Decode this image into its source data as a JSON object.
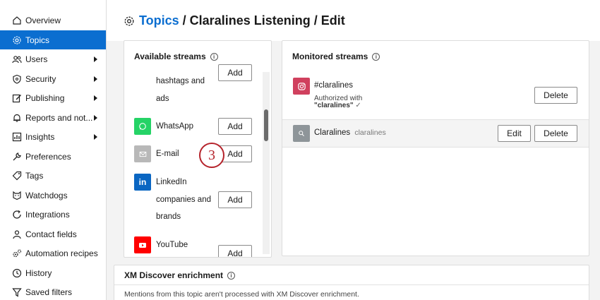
{
  "sidebar": {
    "items": [
      {
        "label": "Overview",
        "icon": "home-icon",
        "has_submenu": false,
        "active": false
      },
      {
        "label": "Topics",
        "icon": "gear-icon",
        "has_submenu": false,
        "active": true
      },
      {
        "label": "Users",
        "icon": "users-icon",
        "has_submenu": true,
        "active": false
      },
      {
        "label": "Security",
        "icon": "shield-icon",
        "has_submenu": true,
        "active": false
      },
      {
        "label": "Publishing",
        "icon": "pencil-icon",
        "has_submenu": true,
        "active": false
      },
      {
        "label": "Reports and not...",
        "icon": "bell-icon",
        "has_submenu": true,
        "active": false
      },
      {
        "label": "Insights",
        "icon": "chart-icon",
        "has_submenu": true,
        "active": false
      },
      {
        "label": "Preferences",
        "icon": "wrench-icon",
        "has_submenu": false,
        "active": false
      },
      {
        "label": "Tags",
        "icon": "tag-icon",
        "has_submenu": false,
        "active": false
      },
      {
        "label": "Watchdogs",
        "icon": "dog-icon",
        "has_submenu": false,
        "active": false
      },
      {
        "label": "Integrations",
        "icon": "refresh-icon",
        "has_submenu": false,
        "active": false
      },
      {
        "label": "Contact fields",
        "icon": "person-icon",
        "has_submenu": false,
        "active": false
      },
      {
        "label": "Automation recipes",
        "icon": "cogs-icon",
        "has_submenu": false,
        "active": false
      },
      {
        "label": "History",
        "icon": "clock-icon",
        "has_submenu": false,
        "active": false
      },
      {
        "label": "Saved filters",
        "icon": "filter-icon",
        "has_submenu": false,
        "active": false
      }
    ]
  },
  "header": {
    "title_link": "Topics",
    "title_rest": "/ Claralines Listening / Edit"
  },
  "available": {
    "title": "Available streams",
    "add_label": "Add",
    "partial_top_label": "hashtags and",
    "partial_top_label2": "ads",
    "streams": [
      {
        "label": "WhatsApp",
        "icon": "whatsapp-icon",
        "color": "#25d366"
      },
      {
        "label": "E-mail",
        "icon": "envelope-icon",
        "color": "#b8b8b8"
      },
      {
        "label_lines": [
          "LinkedIn",
          "companies and",
          "brands"
        ],
        "icon": "linkedin-icon",
        "color": "#0a66c2"
      },
      {
        "label": "YouTube",
        "icon": "youtube-icon",
        "color": "#ff0000"
      }
    ]
  },
  "monitored": {
    "title": "Monitored streams",
    "instagram": {
      "handle": "#claralines",
      "auth_text": "Authorized with",
      "auth_account": "\"claralines\"",
      "check": "✓",
      "delete_label": "Delete",
      "color": "#c13584"
    },
    "search_stream": {
      "name": "Claralines",
      "sub": "claralines",
      "edit_label": "Edit",
      "delete_label": "Delete",
      "color": "#8e9599"
    }
  },
  "enrichment": {
    "title": "XM Discover enrichment",
    "text": "Mentions from this topic aren't processed with XM Discover enrichment."
  },
  "step": {
    "number": "3"
  }
}
